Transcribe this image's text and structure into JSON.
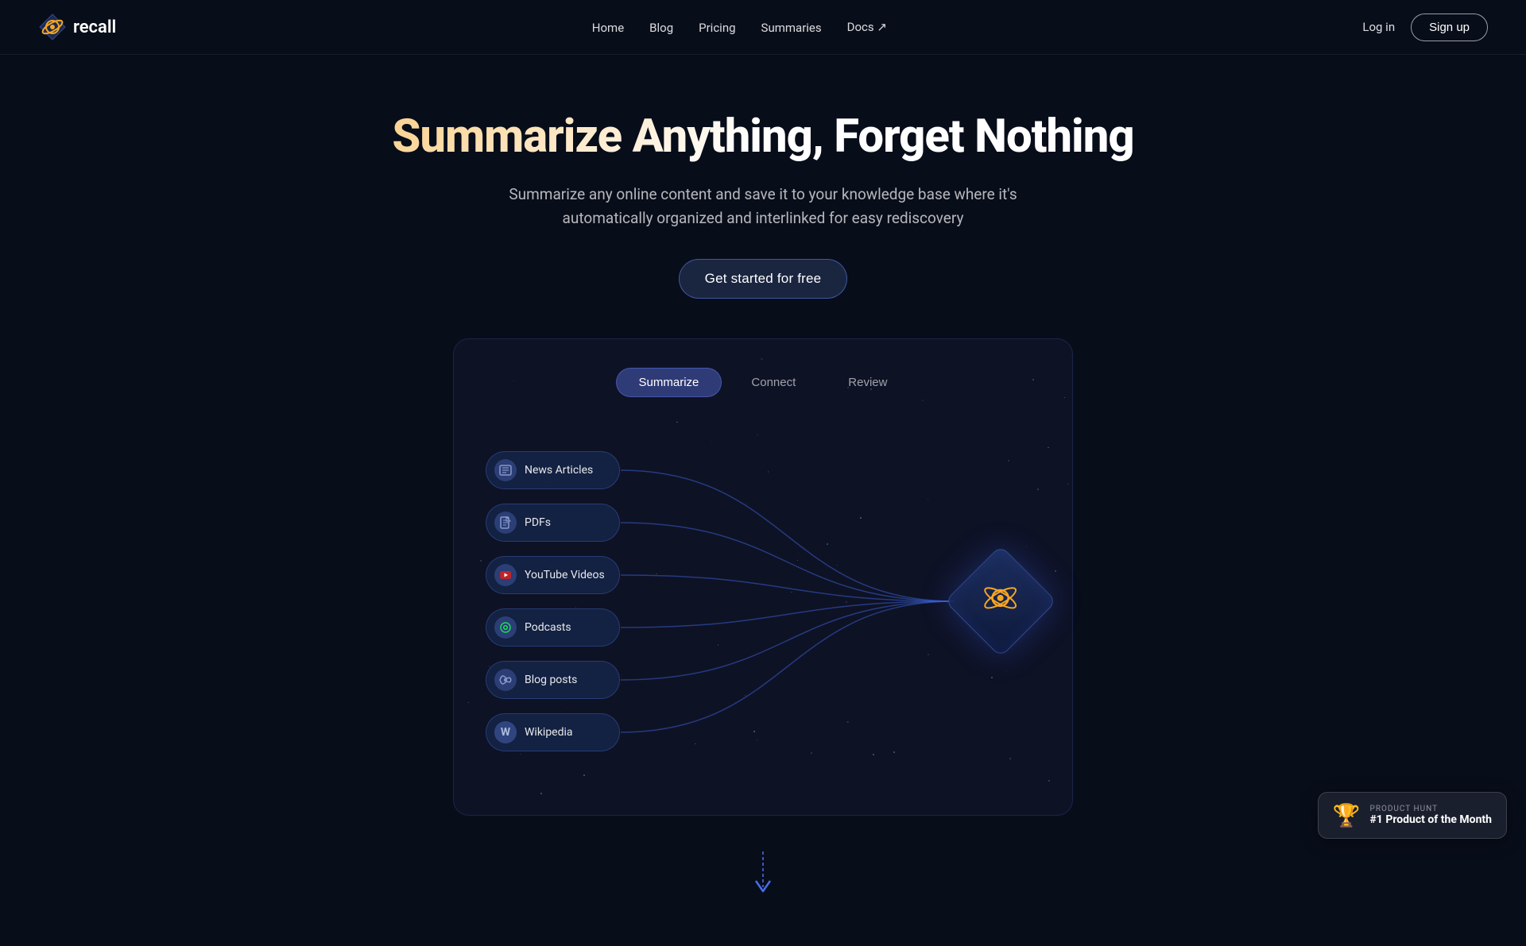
{
  "nav": {
    "logo_text": "recall",
    "links": [
      {
        "label": "Home",
        "href": "#"
      },
      {
        "label": "Blog",
        "href": "#"
      },
      {
        "label": "Pricing",
        "href": "#"
      },
      {
        "label": "Summaries",
        "href": "#"
      },
      {
        "label": "Docs ↗",
        "href": "#"
      }
    ],
    "login_label": "Log in",
    "signup_label": "Sign up"
  },
  "hero": {
    "title": "Summarize Anything, Forget Nothing",
    "subtitle": "Summarize any online content and save it to your knowledge base where it's automatically organized and interlinked for easy rediscovery",
    "cta_label": "Get started for free"
  },
  "tabs": [
    {
      "label": "Summarize",
      "active": true
    },
    {
      "label": "Connect",
      "active": false
    },
    {
      "label": "Review",
      "active": false
    }
  ],
  "source_nodes": [
    {
      "label": "News Articles",
      "icon": "📰",
      "icon_type": "news"
    },
    {
      "label": "PDFs",
      "icon": "📄",
      "icon_type": "pdf"
    },
    {
      "label": "YouTube Videos",
      "icon": "▶",
      "icon_type": "youtube"
    },
    {
      "label": "Podcasts",
      "icon": "🎵",
      "icon_type": "podcast"
    },
    {
      "label": "Blog posts",
      "icon": "📡",
      "icon_type": "blog"
    },
    {
      "label": "Wikipedia",
      "icon": "W",
      "icon_type": "wiki"
    }
  ],
  "product_hunt": {
    "label": "PRODUCT HUNT",
    "title": "#1 Product of the Month"
  },
  "colors": {
    "bg": "#080d1a",
    "accent": "#4466ff",
    "node_bg": "#141e46",
    "orb_glow": "#3366ff"
  }
}
